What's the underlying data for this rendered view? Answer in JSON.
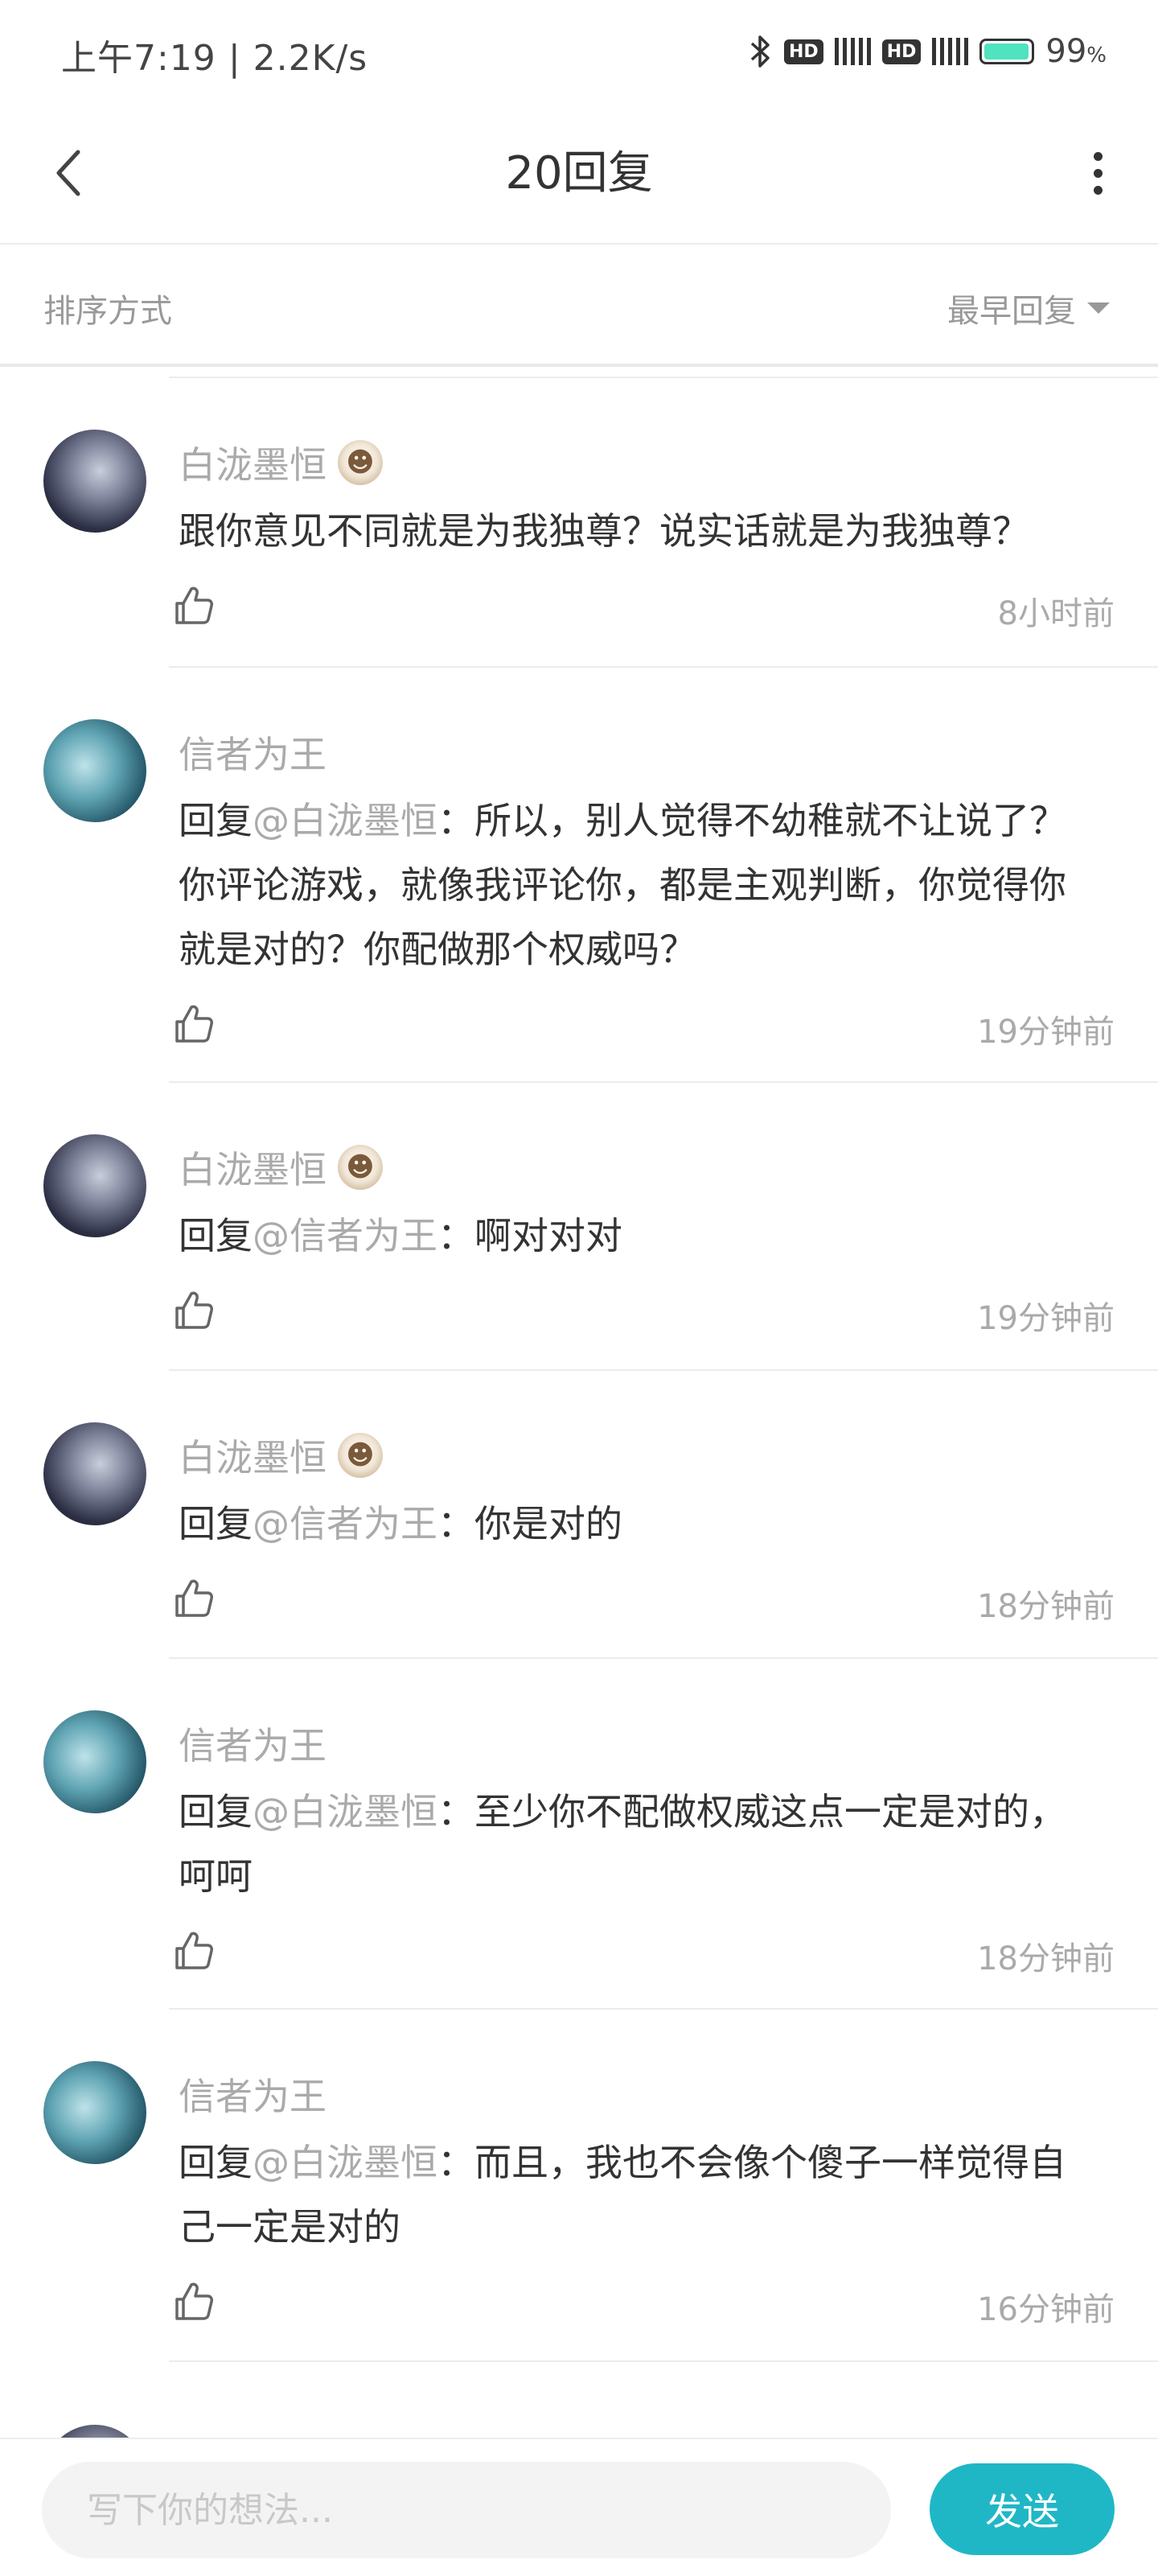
{
  "status_bar": {
    "time": "上午7:19",
    "speed": "2.2K/s",
    "hd1": "HD",
    "hd2": "HD",
    "battery_percent": "99",
    "battery_unit": "%",
    "battery_level": 0.99
  },
  "header": {
    "title": "20回复"
  },
  "sort": {
    "label": "排序方式",
    "selected": "最早回复"
  },
  "comments": [
    {
      "name": "白泷墨恒",
      "has_badge": true,
      "prefix": "",
      "mention": "",
      "sep": "",
      "text": "跟你意见不同就是为我独尊？说实话就是为我独尊？",
      "time": "8小时前",
      "avatar": "bai"
    },
    {
      "name": "信者为王",
      "has_badge": false,
      "prefix": "回复",
      "mention": "@白泷墨恒",
      "sep": "：",
      "text": "所以，别人觉得不幼稚就不让说了？你评论游戏，就像我评论你，都是主观判断，你觉得你就是对的？你配做那个权威吗？",
      "time": "19分钟前",
      "avatar": "xin"
    },
    {
      "name": "白泷墨恒",
      "has_badge": true,
      "prefix": "回复",
      "mention": "@信者为王",
      "sep": "：",
      "text": "啊对对对",
      "time": "19分钟前",
      "avatar": "bai"
    },
    {
      "name": "白泷墨恒",
      "has_badge": true,
      "prefix": "回复",
      "mention": "@信者为王",
      "sep": "：",
      "text": "你是对的",
      "time": "18分钟前",
      "avatar": "bai"
    },
    {
      "name": "信者为王",
      "has_badge": false,
      "prefix": "回复",
      "mention": "@白泷墨恒",
      "sep": "：",
      "text": "至少你不配做权威这点一定是对的，呵呵",
      "time": "18分钟前",
      "avatar": "xin"
    },
    {
      "name": "信者为王",
      "has_badge": false,
      "prefix": "回复",
      "mention": "@白泷墨恒",
      "sep": "：",
      "text": "而且，我也不会像个傻子一样觉得自己一定是对的",
      "time": "16分钟前",
      "avatar": "xin"
    }
  ],
  "input": {
    "placeholder": "写下你的想法...",
    "send_label": "发送"
  }
}
